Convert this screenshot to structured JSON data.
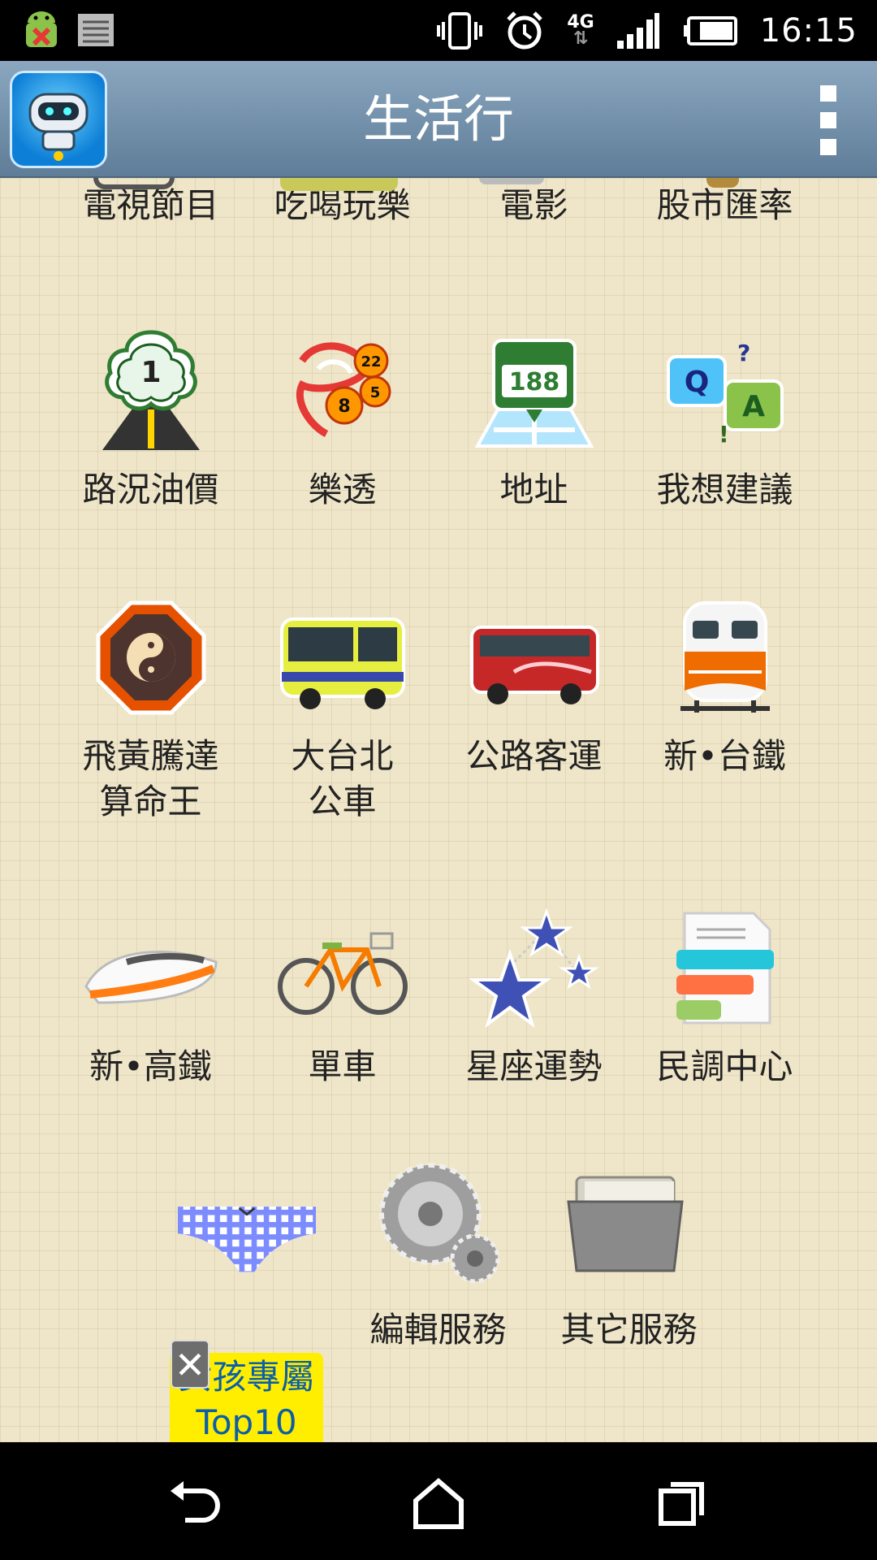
{
  "status_bar": {
    "time": "16:15",
    "network": "4G",
    "icons": [
      "android-debug-icon",
      "notes-icon",
      "vibrate-icon",
      "alarm-icon",
      "network-4g-icon",
      "signal-icon",
      "battery-icon"
    ]
  },
  "app_bar": {
    "title": "生活行",
    "overflow_icon": "overflow-menu-icon"
  },
  "items_row0": [
    "電視節目",
    "吃喝玩樂",
    "電影",
    "股市匯率"
  ],
  "items_row1": [
    "路況油價",
    "樂透",
    "地址",
    "我想建議"
  ],
  "items_row2": [
    "飛黃騰達\n算命王",
    "大台北\n公車",
    "公路客運",
    "新•台鐵"
  ],
  "items_row3": [
    "新•高鐵",
    "單車",
    "星座運勢",
    "民調中心"
  ],
  "items_row4": [
    "女孩專屬\nTop10",
    "編輯服務",
    "其它服務"
  ],
  "icons": {
    "road": "188",
    "lotto": [
      "22",
      "5",
      "8"
    ],
    "qa": [
      "Q",
      "A"
    ]
  },
  "close_label": "✕"
}
